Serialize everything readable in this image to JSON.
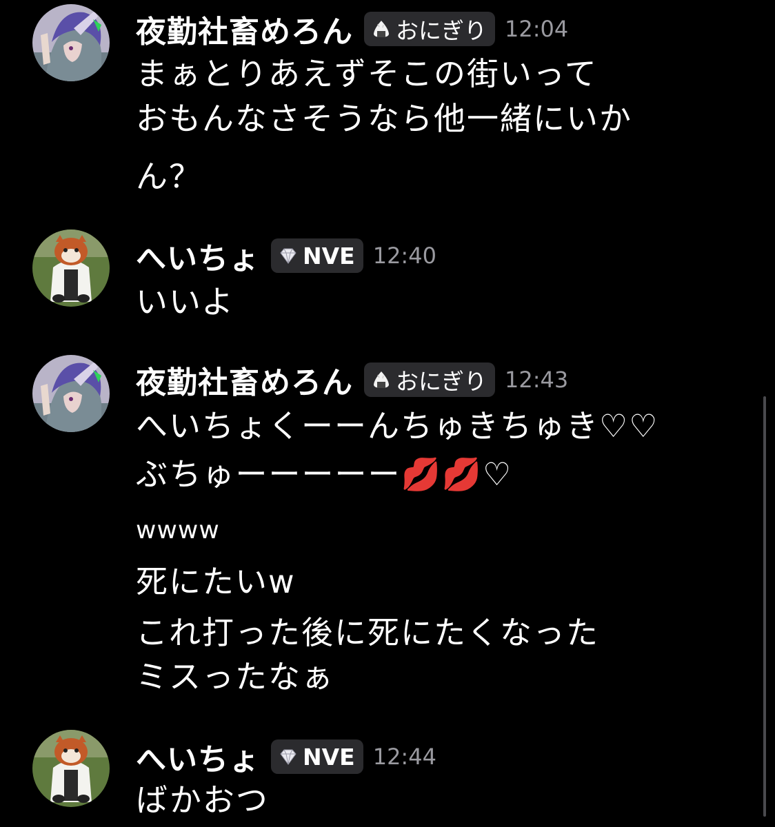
{
  "messages": [
    {
      "username": "夜勤社畜めろん",
      "role": "おにぎり",
      "role_icon": "onigiri-icon",
      "time": "12:04",
      "lines": [
        "まぁとりあえずそこの街いって",
        "おもんなさそうなら他一緒にいか",
        "ん？"
      ]
    },
    {
      "username": "へいちょ",
      "role": "NVE",
      "role_icon": "diamond-icon",
      "time": "12:40",
      "lines": [
        "いいよ"
      ]
    },
    {
      "username": "夜勤社畜めろん",
      "role": "おにぎり",
      "role_icon": "onigiri-icon",
      "time": "12:43",
      "lines": [
        "へいちょくーーんちゅきちゅき♡♡",
        "ぶちゅーーーーー💋💋♡",
        "wwww",
        "死にたいw",
        "これ打った後に死にたくなった",
        "ミスったなぁ"
      ]
    },
    {
      "username": "へいちょ",
      "role": "NVE",
      "role_icon": "diamond-icon",
      "time": "12:44",
      "lines": [
        "ばかおつ"
      ]
    }
  ],
  "colors": {
    "background": "#000000",
    "text": "#ffffff",
    "timestamp": "#9a9aa0",
    "badge": "#2b2b2e"
  }
}
